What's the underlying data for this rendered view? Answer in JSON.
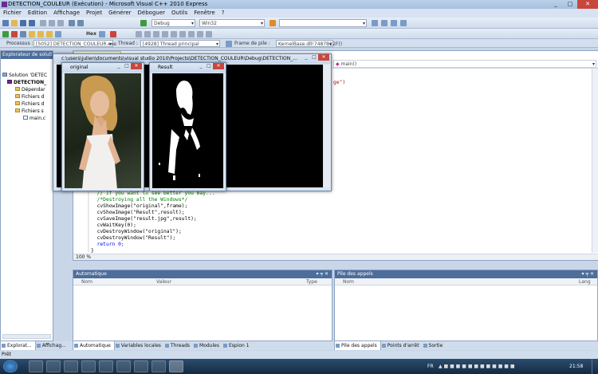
{
  "window": {
    "title": "DETECTION_COULEUR (Exécution) - Microsoft Visual C++ 2010 Express"
  },
  "menu": [
    "Fichier",
    "Edition",
    "Affichage",
    "Projet",
    "Générer",
    "Déboguer",
    "Outils",
    "Fenêtre",
    "?"
  ],
  "toolbar": {
    "config_value": "Debug",
    "platform_value": "Win32",
    "hex_label": "Hex"
  },
  "debug_location": {
    "processus_label": "Processus :",
    "processus_value": "[5052] DETECTION_COULEUR.exe",
    "thread_label": "Thread :",
    "thread_value": "[4928] Thread principal",
    "frame_label": "Frame de pile :",
    "frame_value": "KernelBase.dll!7487B12F()"
  },
  "solution_explorer": {
    "title": "Explorateur de soluti...",
    "items": [
      "Solution 'DETEC",
      "DETECTION_",
      "Dépendar",
      "Fichiers d",
      "Fichiers d",
      "Fichiers s",
      "main.c"
    ]
  },
  "editor": {
    "function_dropdown": "main()",
    "code_fragment_top": "ge\")",
    "code_lines": [
      "  // if you want to see better you may...",
      "  /*Destroying all the Windows*/",
      "  cvShowImage(\"original\",frame);",
      "  cvShowImage(\"Result\",result);",
      "  cvSaveImage(\"result.jpg\",result);",
      "  cvWaitKey(0);",
      "  cvDestroyWindow(\"original\");",
      "  cvDestroyWindow(\"Result\");",
      "  return 0;",
      "}"
    ],
    "zoom": "100 %"
  },
  "opencv_windows": {
    "console_title": "c:\\users\\julien\\documents\\visual studio 2010\\Projects\\DETECTION_COULEUR\\Debug\\DETECTION_...",
    "original_title": "original",
    "result_title": "Result"
  },
  "autos_panel": {
    "title": "Automatique",
    "columns": [
      "Nom",
      "Valeur",
      "Type"
    ]
  },
  "callstack_panel": {
    "title": "Pile des appels",
    "columns": [
      "Nom",
      "Lang"
    ]
  },
  "bottom_tabs_left": [
    "Explorat...",
    "Affichag..."
  ],
  "bottom_tabs": [
    "Automatique",
    "Variables locales",
    "Threads",
    "Modules",
    "Espion 1"
  ],
  "bottom_tabs_right": [
    "Pile des appels",
    "Points d'arrêt",
    "Sortie"
  ],
  "status": "Prêt",
  "taskbar": {
    "lang": "FR",
    "clock": "21:58"
  },
  "colors": {
    "panel_header": "#4d6d9a",
    "close_button": "#c9463d",
    "taskbar": "#1c3650"
  }
}
